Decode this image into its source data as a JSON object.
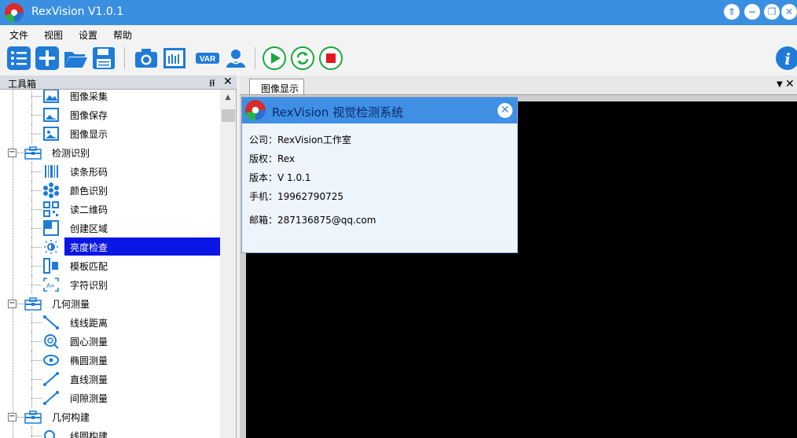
{
  "window": {
    "title": "RexVision V1.0.1",
    "controls": [
      "⇑",
      "−",
      "❐",
      "✕"
    ]
  },
  "menu": [
    "文件",
    "视图",
    "设置",
    "帮助"
  ],
  "toolbar": {
    "var_label": "VAR",
    "info_label": "i"
  },
  "toolbox": {
    "title": "工具箱",
    "pin": "ᵖ",
    "close": "✕",
    "items": [
      {
        "label": "图像采集",
        "kind": "child",
        "icon": "image-acquire-icon"
      },
      {
        "label": "图像保存",
        "kind": "child",
        "icon": "image-save-icon"
      },
      {
        "label": "图像显示",
        "kind": "child",
        "icon": "image-display-icon"
      },
      {
        "label": "检测识别",
        "kind": "group",
        "icon": "toolbox-folder-icon"
      },
      {
        "label": "读条形码",
        "kind": "child",
        "icon": "barcode-icon"
      },
      {
        "label": "颜色识别",
        "kind": "child",
        "icon": "color-icon"
      },
      {
        "label": "读二维码",
        "kind": "child",
        "icon": "qrcode-icon"
      },
      {
        "label": "创建区域",
        "kind": "child",
        "icon": "region-icon"
      },
      {
        "label": "亮度检查",
        "kind": "child",
        "icon": "brightness-icon",
        "selected": true
      },
      {
        "label": "模板匹配",
        "kind": "child",
        "icon": "template-icon"
      },
      {
        "label": "字符识别",
        "kind": "child",
        "icon": "ocr-icon"
      },
      {
        "label": "几何测量",
        "kind": "group",
        "icon": "toolbox-folder-icon"
      },
      {
        "label": "线线距离",
        "kind": "child",
        "icon": "line-distance-icon"
      },
      {
        "label": "圆心测量",
        "kind": "child",
        "icon": "circle-measure-icon"
      },
      {
        "label": "椭圆测量",
        "kind": "child",
        "icon": "ellipse-measure-icon"
      },
      {
        "label": "直线测量",
        "kind": "child",
        "icon": "line-measure-icon"
      },
      {
        "label": "间隙测量",
        "kind": "child",
        "icon": "gap-measure-icon"
      },
      {
        "label": "几何构建",
        "kind": "group",
        "icon": "toolbox-folder-icon"
      },
      {
        "label": "线圆构建",
        "kind": "child",
        "icon": "line-circle-icon"
      }
    ]
  },
  "document": {
    "tab_label": "图像显示"
  },
  "about": {
    "title": "RexVision 视觉检测系统",
    "company": "公司：RexVision工作室",
    "copyright": "版权：Rex",
    "version": "版本：V 1.0.1",
    "phone": "手机：19962790725",
    "email": "邮箱：287136875@qq.com"
  },
  "colors": {
    "titlebar": "#3b8fe0",
    "selection": "#0a16e6",
    "accent_green": "#1aa83a",
    "stop_red": "#e01919"
  }
}
